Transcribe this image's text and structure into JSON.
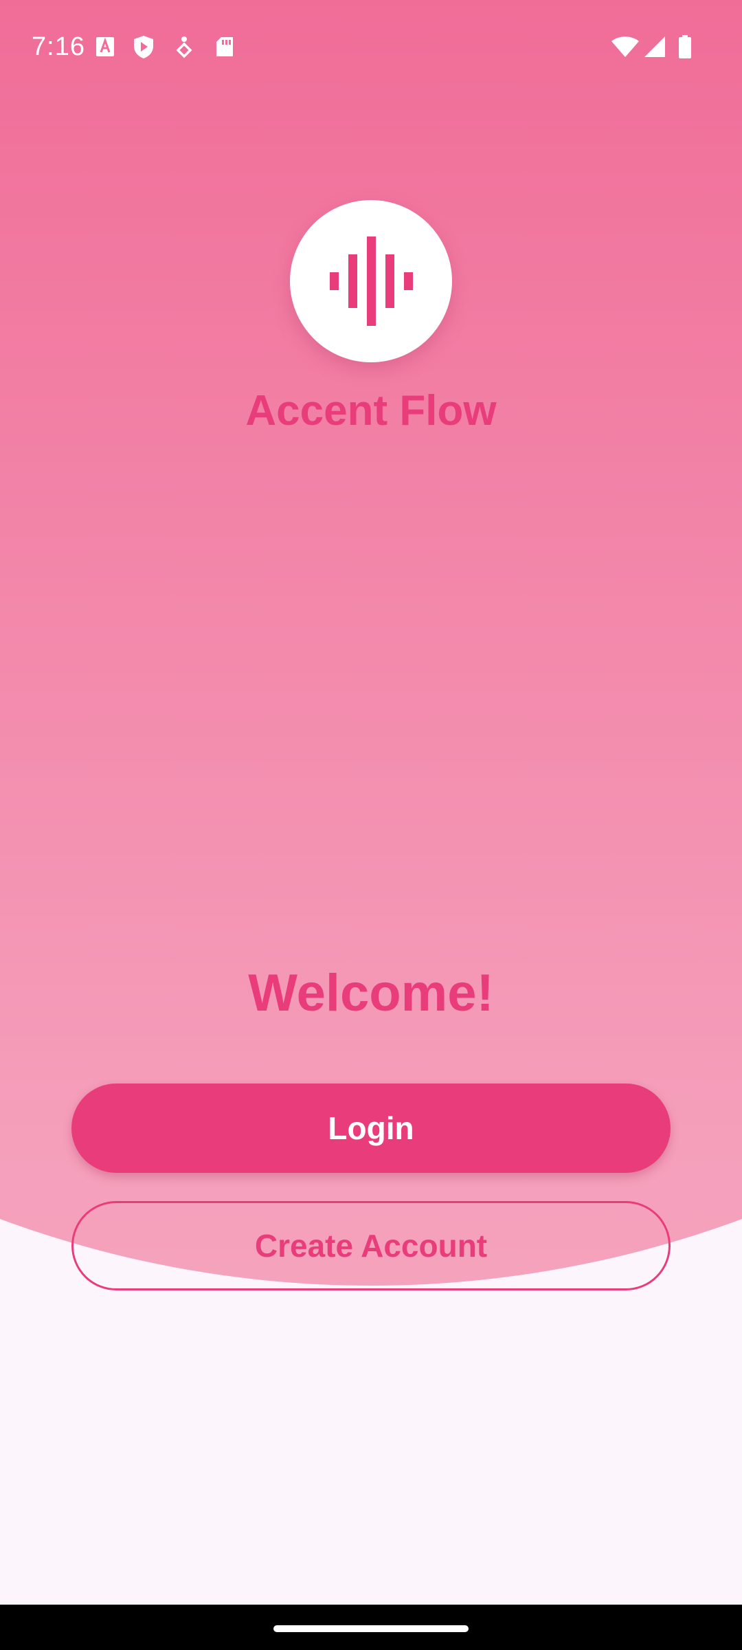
{
  "status_bar": {
    "time": "7:16",
    "left_icons": [
      "font-a-icon",
      "shield-play-icon",
      "accessibility-icon",
      "sd-card-icon"
    ],
    "right_icons": [
      "wifi-icon",
      "cellular-signal-icon",
      "battery-icon"
    ]
  },
  "logo": {
    "icon": "sound-wave-icon"
  },
  "app_name": "Accent Flow",
  "welcome_text": "Welcome!",
  "buttons": {
    "login": "Login",
    "create_account": "Create Account"
  },
  "colors": {
    "accent": "#e93d7b",
    "gradient_top": "#f06d98",
    "gradient_bottom": "#f5a2bd",
    "background": "#fcf5fc"
  }
}
